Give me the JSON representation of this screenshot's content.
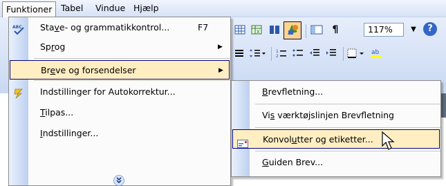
{
  "menubar": {
    "items": [
      {
        "label": "Funktioner",
        "active": true
      },
      {
        "label": "Tabel"
      },
      {
        "label": "Vindue"
      },
      {
        "label": "Hjælp"
      }
    ]
  },
  "toolbar": {
    "zoom": "117%",
    "icons": [
      "insert-table-icon",
      "insert-excel-icon",
      "columns-icon",
      "drawing-icon",
      "document-map-icon",
      "show-formatting-icon",
      "help-icon"
    ],
    "row2_icons": [
      "justify-icon",
      "line-spacing-icon",
      "numbering-icon",
      "bullets-icon",
      "decrease-indent-icon",
      "increase-indent-icon",
      "borders-icon",
      "highlight-icon"
    ]
  },
  "main_menu": {
    "items": [
      {
        "label": "Stave- og grammatikkontrol...",
        "shortcut": "F7",
        "icon": "spelling-check-icon"
      },
      {
        "label": "Sprog",
        "submenu": true
      },
      {
        "label": "Breve og forsendelser",
        "submenu": true,
        "highlighted": true
      },
      {
        "label": "Indstillinger for Autokorrektur...",
        "icon": "autocorrect-icon"
      },
      {
        "label": "Tilpas..."
      },
      {
        "label": "Indstillinger..."
      }
    ],
    "expand_icon": "double-chevron-down-icon"
  },
  "sub_menu": {
    "items": [
      {
        "label": "Brevfletning..."
      },
      {
        "label": "Vis værktøjslinjen Brevfletning"
      },
      {
        "label": "Konvolutter og etiketter...",
        "icon": "envelope-icon",
        "highlighted": true
      },
      {
        "label": "Guiden Brev..."
      }
    ]
  },
  "colors": {
    "highlight_fill": "#ffeec2",
    "highlight_border": "#000080",
    "gutter_start": "#eaf1fd",
    "gutter_end": "#bdd0ef"
  }
}
